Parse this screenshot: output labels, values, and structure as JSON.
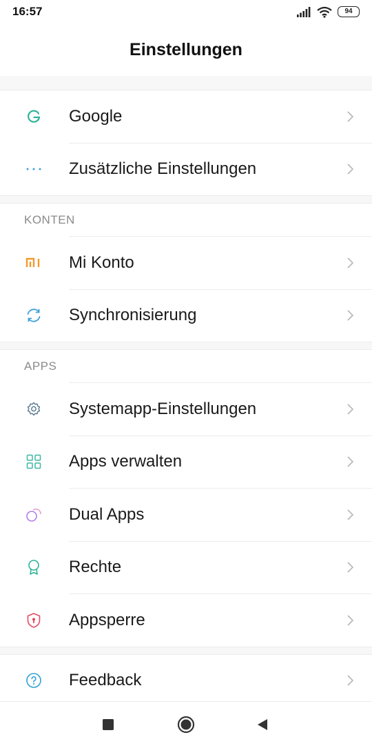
{
  "status": {
    "time": "16:57",
    "battery": "94"
  },
  "header": {
    "title": "Einstellungen"
  },
  "groups": [
    {
      "items": [
        {
          "label": "Google",
          "icon": "google-icon"
        },
        {
          "label": "Zusätzliche Einstellungen",
          "icon": "more-dots-icon"
        }
      ]
    },
    {
      "title": "KONTEN",
      "items": [
        {
          "label": "Mi Konto",
          "icon": "mi-logo-icon"
        },
        {
          "label": "Synchronisierung",
          "icon": "sync-icon"
        }
      ]
    },
    {
      "title": "APPS",
      "items": [
        {
          "label": "Systemapp-Einstellungen",
          "icon": "gear-icon"
        },
        {
          "label": "Apps verwalten",
          "icon": "grid-icon"
        },
        {
          "label": "Dual Apps",
          "icon": "dual-circles-icon"
        },
        {
          "label": "Rechte",
          "icon": "badge-icon"
        },
        {
          "label": "Appsperre",
          "icon": "shield-lock-icon"
        }
      ]
    },
    {
      "items": [
        {
          "label": "Feedback",
          "icon": "help-circle-icon"
        }
      ]
    }
  ],
  "colors": {
    "google": "#2fb39a",
    "dots": "#3fa0e0",
    "mi": "#f39a2d",
    "sync": "#3b9fd6",
    "gear": "#5f7e95",
    "grid": "#3fb7a4",
    "dual": "#b07ee6",
    "badge": "#2fb39a",
    "shield": "#e64a62",
    "help": "#2f9fd6"
  }
}
